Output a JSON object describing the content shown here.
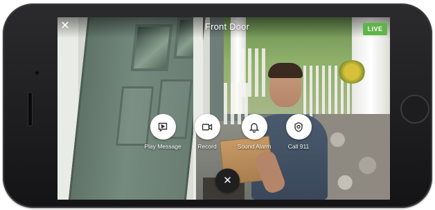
{
  "header": {
    "title": "Front Door",
    "live_badge": "LIVE",
    "close_icon": "close-icon"
  },
  "actions": [
    {
      "label": "Play Message",
      "icon": "play-message-icon"
    },
    {
      "label": "Record",
      "icon": "video-camera-icon"
    },
    {
      "label": "Sound Alarm",
      "icon": "bell-icon"
    },
    {
      "label": "Call 911",
      "icon": "police-badge-icon"
    }
  ],
  "dismiss": {
    "icon": "close-icon",
    "glyph": "✕"
  },
  "colors": {
    "live_badge": "#5fb548",
    "action_circle": "#ffffff",
    "dismiss_button": "#1f1f1f",
    "icon_stroke": "#333333"
  }
}
